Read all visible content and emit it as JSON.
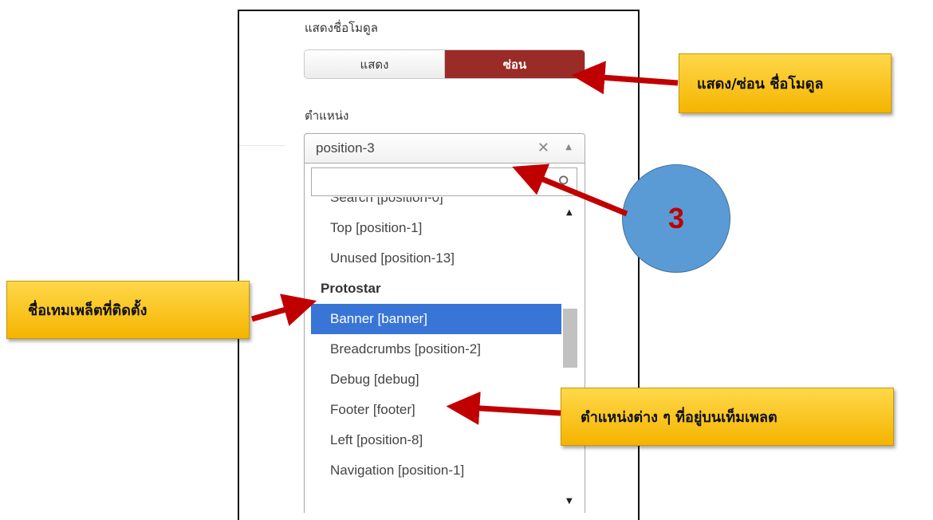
{
  "module_title": {
    "label": "แสดงชื่อโมดูล",
    "show_label": "แสดง",
    "hide_label": "ซ่อน",
    "selected": "ซ่อน"
  },
  "position": {
    "label": "ตำแหน่ง",
    "selected_value": "position-3",
    "clear_glyph": "✕",
    "arrow_glyph": "▲",
    "search_placeholder": "",
    "search_icon_glyph": "⚲",
    "items": [
      {
        "label": "Search [position-0]",
        "type": "option"
      },
      {
        "label": "Top [position-1]",
        "type": "option"
      },
      {
        "label": "Unused [position-13]",
        "type": "option"
      },
      {
        "label": "Protostar",
        "type": "group"
      },
      {
        "label": "Banner [banner]",
        "type": "option",
        "highlighted": true
      },
      {
        "label": "Breadcrumbs [position-2]",
        "type": "option"
      },
      {
        "label": "Debug [debug]",
        "type": "option"
      },
      {
        "label": "Footer [footer]",
        "type": "option"
      },
      {
        "label": "Left [position-8]",
        "type": "option"
      },
      {
        "label": "Navigation [position-1]",
        "type": "option"
      }
    ],
    "scroll_up_glyph": "▲",
    "scroll_down_glyph": "▼"
  },
  "annotations": {
    "show_hide_callout": "แสดง/ซ่อน ชื่อโมดูล",
    "template_name_callout": "ชื่อเทมเพล็ตที่ติดตั้ง",
    "positions_callout": "ตำแหน่งต่าง ๆ ที่อยู่บนเท็มเพลต",
    "step_number": "3"
  },
  "colors": {
    "hide_button": "#9b2b26",
    "highlight": "#3875d7",
    "callout": "#f5b400",
    "arrow": "#c00000",
    "circle": "#5b9bd5"
  }
}
